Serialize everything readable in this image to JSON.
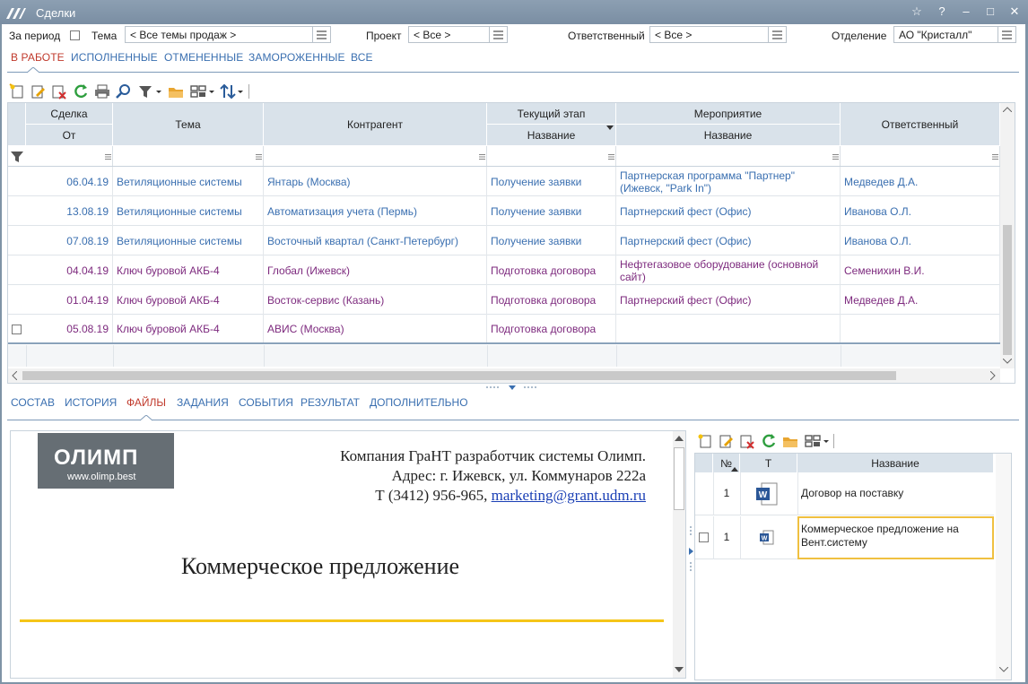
{
  "window": {
    "title": "Сделки"
  },
  "titlebar_controls": [
    "star-icon",
    "help-icon",
    "minimize-icon",
    "maximize-icon",
    "close-icon"
  ],
  "help_label": "?",
  "filters": {
    "period_label": "За период",
    "theme_label": "Тема",
    "theme_value": "< Все темы продаж >",
    "project_label": "Проект",
    "project_value": "< Все >",
    "responsible_label": "Ответственный",
    "responsible_value": "< Все >",
    "department_label": "Отделение",
    "department_value": "АО \"Кристалл\""
  },
  "status_tabs": [
    "В РАБОТЕ",
    "ИСПОЛНЕННЫЕ",
    "ОТМЕНЕННЫЕ",
    "ЗАМОРОЖЕННЫЕ",
    "ВСЕ"
  ],
  "grid": {
    "headers": {
      "deal": "Сделка",
      "deal_from": "От",
      "theme": "Тема",
      "counterparty": "Контрагент",
      "stage": "Текущий этап",
      "stage_name": "Название",
      "event": "Мероприятие",
      "event_name": "Название",
      "responsible": "Ответственный"
    },
    "rows": [
      {
        "date": "06.04.19",
        "theme": "Ветиляционные системы",
        "counterparty": "Янтарь (Москва)",
        "stage": "Получение заявки",
        "event": "Партнерская программа \"Партнер\" (Ижевск, \"Park In\")",
        "responsible": "Медведев Д.А.",
        "color": "blue"
      },
      {
        "date": "13.08.19",
        "theme": "Ветиляционные системы",
        "counterparty": "Автоматизация учета (Пермь)",
        "stage": "Получение заявки",
        "event": "Партнерский фест (Офис)",
        "responsible": "Иванова О.Л.",
        "color": "blue"
      },
      {
        "date": "07.08.19",
        "theme": "Ветиляционные системы",
        "counterparty": "Восточный квартал (Санкт-Петербург)",
        "stage": "Получение заявки",
        "event": "Партнерский фест (Офис)",
        "responsible": "Иванова О.Л.",
        "color": "blue"
      },
      {
        "date": "04.04.19",
        "theme": "Ключ буровой АКБ-4",
        "counterparty": "Глобал (Ижевск)",
        "stage": "Подготовка договора",
        "event": "Нефтегазовое оборудование (основной сайт)",
        "responsible": "Семенихин В.И.",
        "color": "purple"
      },
      {
        "date": "01.04.19",
        "theme": "Ключ буровой АКБ-4",
        "counterparty": "Восток-сервис (Казань)",
        "stage": "Подготовка договора",
        "event": "Партнерский фест (Офис)",
        "responsible": "Медведев Д.А.",
        "color": "purple"
      },
      {
        "date": "05.08.19",
        "theme": "Ключ буровой АКБ-4",
        "counterparty": "АВИС (Москва)",
        "stage": "Подготовка договора",
        "event": "",
        "responsible": "",
        "color": "purple"
      }
    ]
  },
  "detail_tabs": [
    "СОСТАВ",
    "ИСТОРИЯ",
    "ФАЙЛЫ",
    "ЗАДАНИЯ",
    "СОБЫТИЯ",
    "РЕЗУЛЬТАТ",
    "ДОПОЛНИТЕЛЬНО"
  ],
  "preview": {
    "logo_text": "ОЛИМП",
    "logo_url": "www.olimp.best",
    "company_line": "Компания ГраНТ разработчик системы Олимп.",
    "address_line": "Адрес: г. Ижевск, ул. Коммунаров 222а",
    "phone_line": "Т (3412) 956-965, ",
    "email": "marketing@grant.udm.ru",
    "doc_title": "Коммерческое предложение"
  },
  "files": {
    "headers": {
      "num": "№",
      "type": "Т",
      "name": "Название"
    },
    "rows": [
      {
        "num": "1",
        "name": "Договор на поставку"
      },
      {
        "num": "1",
        "name": "Коммерческое предложение на Вент.систему"
      }
    ]
  },
  "colors": {
    "accent_blue": "#3a6fb0",
    "accent_red": "#c0392b",
    "purple": "#7d2a7e",
    "header_bg": "#d9e2ea",
    "title_bg": "#8396aa",
    "selection": "#f0c040"
  }
}
